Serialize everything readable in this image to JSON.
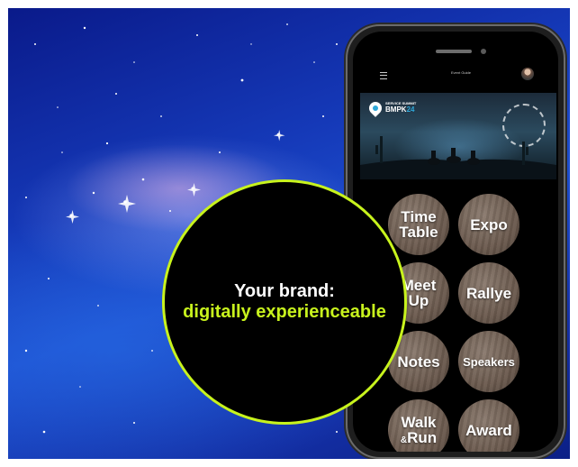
{
  "app": {
    "top_title": "Event Guide",
    "banner": {
      "brand_small": "SERVICE SUMMIT",
      "brand_main": "BMPK",
      "brand_accent": "24"
    }
  },
  "tiles": [
    {
      "line1": "Time",
      "line2": "Table"
    },
    {
      "line1": "Expo",
      "line2": ""
    },
    {
      "line1": "Meet",
      "line2": "Up"
    },
    {
      "line1": "Rallye",
      "line2": ""
    },
    {
      "line1": "Notes",
      "line2": ""
    },
    {
      "line1": "Speakers",
      "line2": ""
    },
    {
      "line1": "Walk",
      "amp": "&",
      "line2": "Run"
    },
    {
      "line1": "Award",
      "line2": ""
    }
  ],
  "overlay": {
    "line1": "Your brand:",
    "line2": "digitally experienceable",
    "accent_color": "#c8f31d"
  },
  "colors": {
    "background": "#1539b8",
    "phone_frame": "#1e1e1e"
  }
}
